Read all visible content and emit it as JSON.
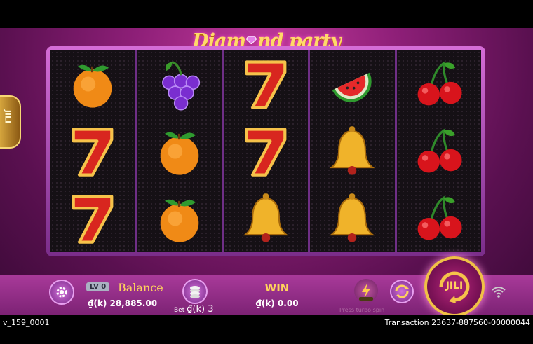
{
  "game": {
    "logo_left": "Diam",
    "logo_right": "nd party",
    "side_tab_label": "JILI"
  },
  "reels": [
    [
      "orange-icon",
      "seven-icon",
      "seven-icon"
    ],
    [
      "grapes-icon",
      "orange-icon",
      "orange-icon"
    ],
    [
      "seven-icon",
      "seven-icon",
      "bell-icon"
    ],
    [
      "watermelon-icon",
      "bell-icon",
      "bell-icon"
    ],
    [
      "cherry-icon",
      "cherry-icon",
      "cherry-icon"
    ]
  ],
  "controls": {
    "level_badge": "LV 0",
    "balance_label": "Balance",
    "balance_value": "₫(k) 28,885.00",
    "bet_prefix": "Bet",
    "bet_value": "₫(k) 3",
    "win_label": "WIN",
    "win_value": "₫(k) 0.00",
    "turbo_hint": "Press turbo spin",
    "spin_label": "JILI"
  },
  "status": {
    "version": "v_159_0001",
    "transaction": "Transaction 23637-887560-00000044"
  }
}
